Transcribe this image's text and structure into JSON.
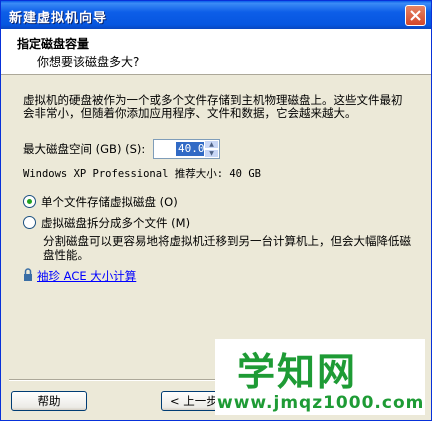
{
  "window": {
    "title": "新建虚拟机向导"
  },
  "header": {
    "title": "指定磁盘容量",
    "subtitle": "你想要该磁盘多大?"
  },
  "description": "虚拟机的硬盘被作为一个或多个文件存储到主机物理磁盘上。这些文件最初会非常小，但随着你添加应用程序、文件和数据，它会越来越大。",
  "disk": {
    "size_label": "最大磁盘空间 (GB) (S):",
    "size_value": "40.0",
    "recommend": "Windows XP Professional 推荐大小: 40 GB"
  },
  "options": {
    "single_file": "单个文件存储虚拟磁盘 (O)",
    "split_files": "虚拟磁盘拆分成多个文件 (M)",
    "split_note": "分割磁盘可以更容易地将虚拟机迁移到另一台计算机上，但会大幅降低磁盘性能。",
    "selected": "single_file"
  },
  "link": {
    "label": "袖珍 ACE 大小计算"
  },
  "buttons": {
    "help": "帮助",
    "back": "< 上一步"
  },
  "watermark": {
    "text": "学知网",
    "url": "www.jmqz1000.com"
  }
}
